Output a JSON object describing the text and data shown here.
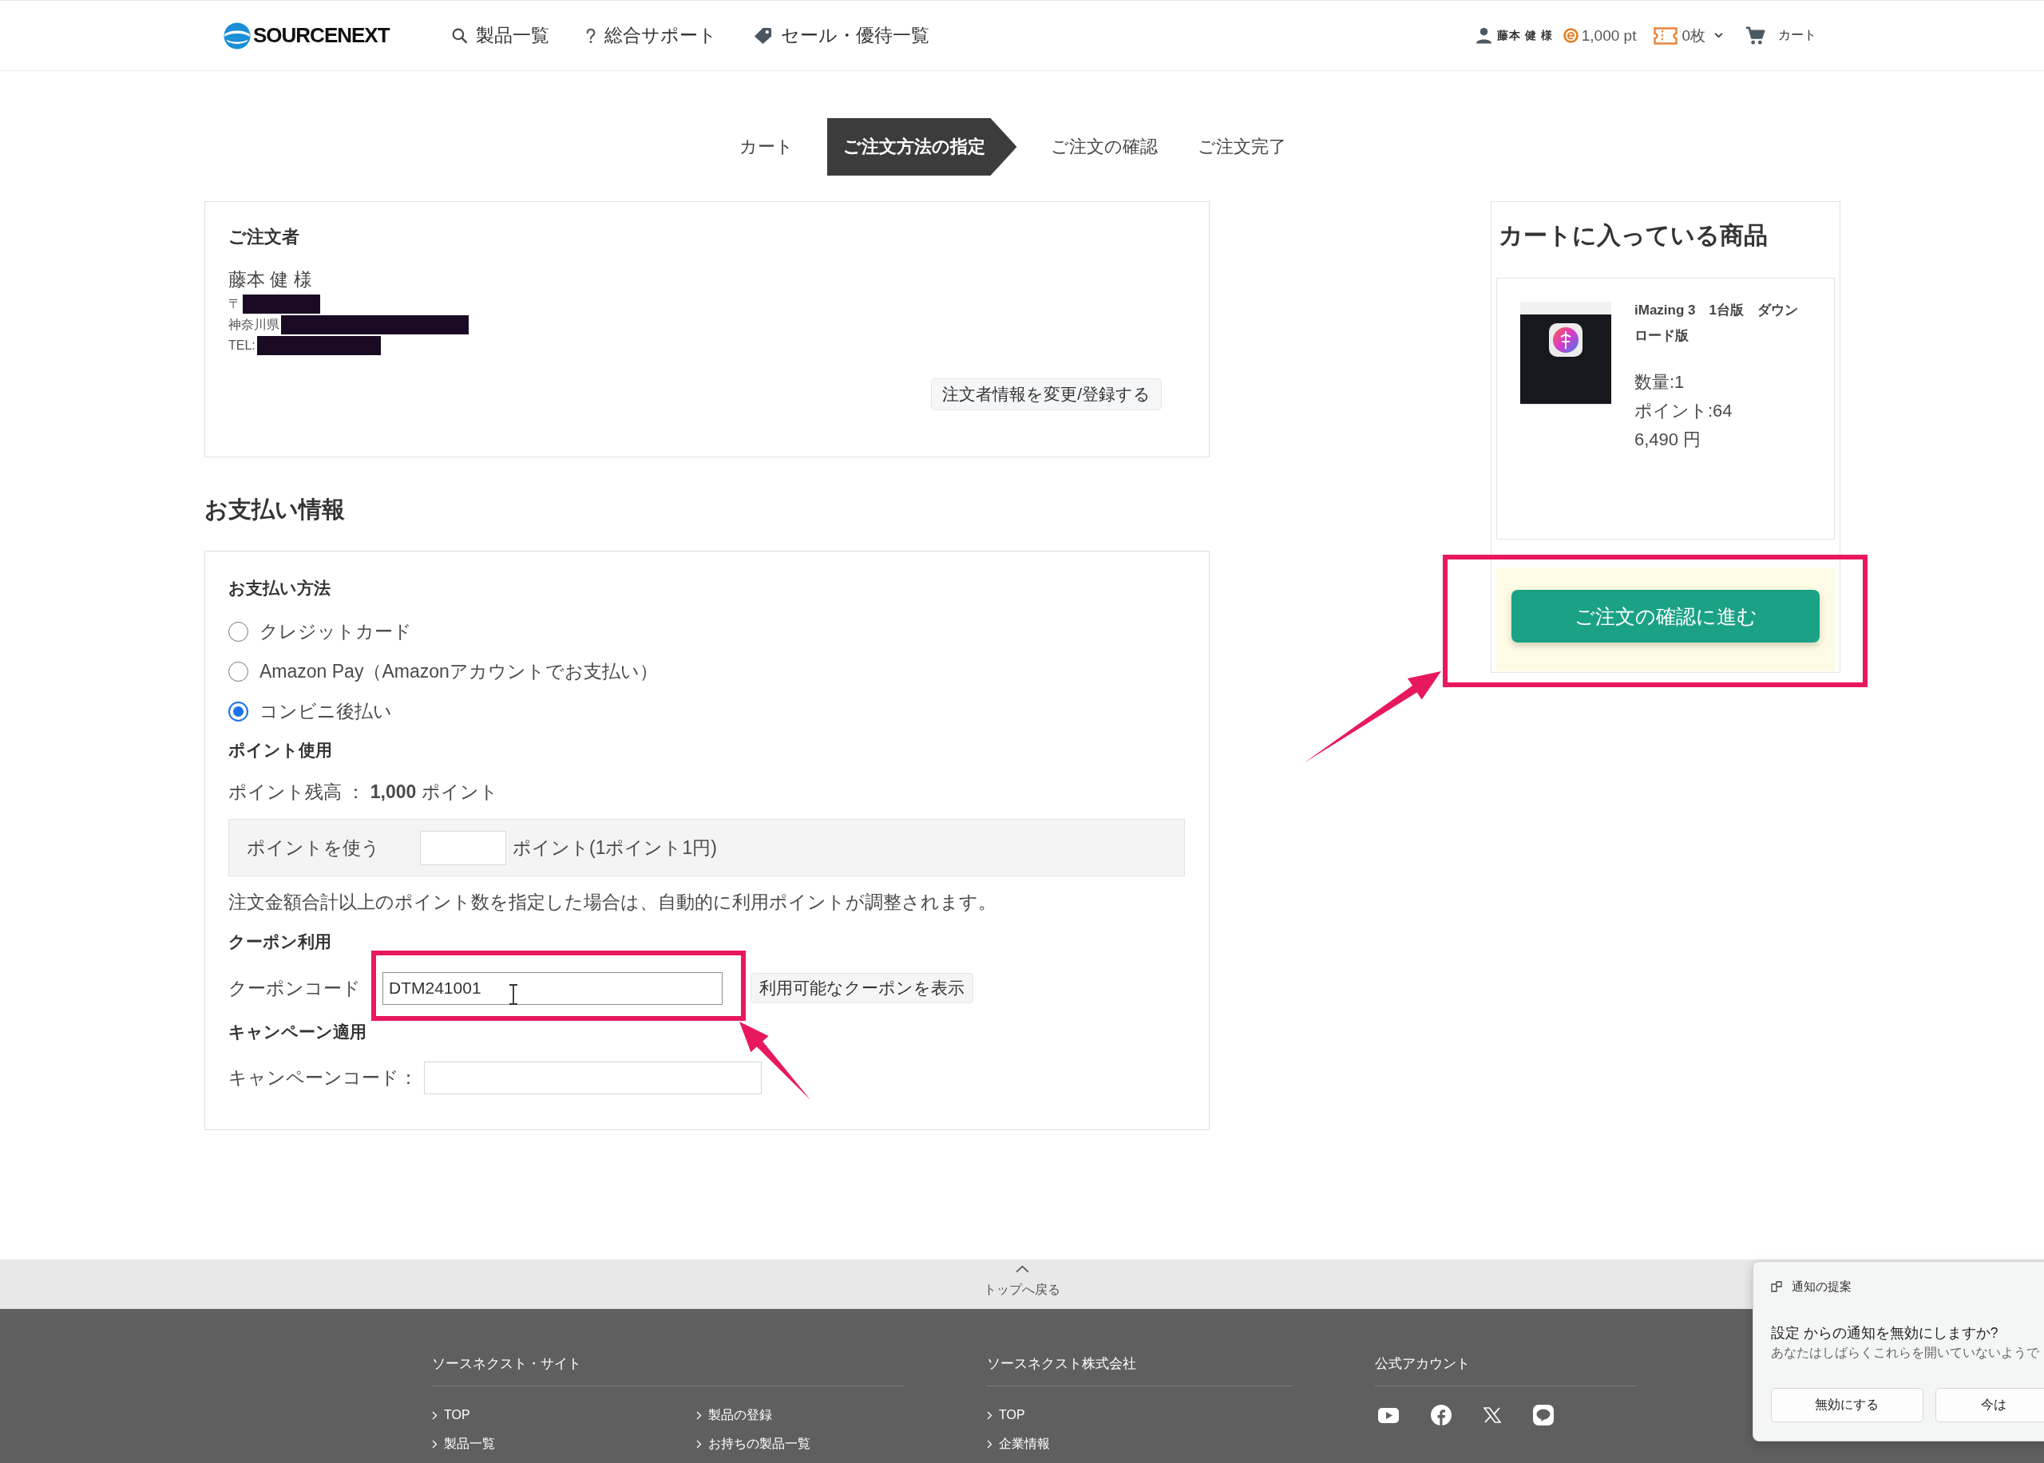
{
  "header": {
    "logo": "SOURCENEXT",
    "nav": [
      {
        "kind": "search",
        "label": "製品一覧"
      },
      {
        "kind": "help",
        "label": "総合サポート"
      },
      {
        "kind": "tag",
        "label": "セール・優待一覧"
      }
    ],
    "user": "藤本 健 様",
    "points": "1,000 pt",
    "coupons": "0枚",
    "cart": "カート"
  },
  "steps": [
    {
      "label": "カート",
      "selected": false
    },
    {
      "label": "ご注文方法の指定",
      "selected": true
    },
    {
      "label": "ご注文の確認",
      "selected": false
    },
    {
      "label": "ご注文完了",
      "selected": false
    }
  ],
  "orderer": {
    "title": "ご注文者",
    "name": "藤本 健 様",
    "lines": [
      {
        "label": "〒",
        "redacted": true
      },
      {
        "label": "神奈川県",
        "redacted": true
      },
      {
        "label": "TEL:",
        "redacted": true
      }
    ],
    "edit_button": "注文者情報を変更/登録する"
  },
  "payment": {
    "heading": "お支払い情報",
    "method_title": "お支払い方法",
    "methods": [
      {
        "label": "クレジットカード",
        "selected": false
      },
      {
        "label": "Amazon Pay（Amazonアカウントでお支払い）",
        "selected": false
      },
      {
        "label": "コンビニ後払い",
        "selected": true
      }
    ],
    "points_title": "ポイント使用",
    "points_balance": "ポイント残高 ： **1,000** ポイント",
    "points_label": "ポイントを使う",
    "points_unit": "ポイント(1ポイント1円)",
    "points_note": "注文金額合計以上のポイント数を指定した場合は、自動的に利用ポイントが調整されます。",
    "coupon_title": "クーポン利用",
    "coupon_label": "クーポンコード",
    "coupon_code": "DTM241001",
    "coupon_button": "利用可能なクーポンを表示",
    "campaign_title": "キャンペーン適用",
    "campaign_label": "キャンペーンコード："
  },
  "cart": {
    "title": "カートに入っている商品",
    "items": [
      {
        "name": "iMazing 3　1台版　ダウンロード版",
        "quantity": "数量:1",
        "points": "ポイント:64",
        "price": "6,490 円"
      }
    ],
    "checkout_button": "ご注文の確認に進む"
  },
  "footer": {
    "back_to_top": "トップへ戻る",
    "columns": [
      {
        "kind": "sitemap",
        "title": "ソースネクスト・サイト",
        "links": [
          "TOP",
          "製品の登録",
          "製品一覧",
          "お持ちの製品一覧"
        ]
      },
      {
        "kind": "links",
        "title": "ソースネクスト株式会社",
        "links": [
          "TOP",
          "企業情報"
        ]
      },
      {
        "kind": "social",
        "title": "公式アカウント"
      }
    ]
  },
  "notification": {
    "header": "通知の提案",
    "title": "設定 からの通知を無効にしますか?",
    "body": "あなたはしばらくこれらを開いていないようで",
    "buttons": [
      "無効にする",
      "今は"
    ]
  }
}
